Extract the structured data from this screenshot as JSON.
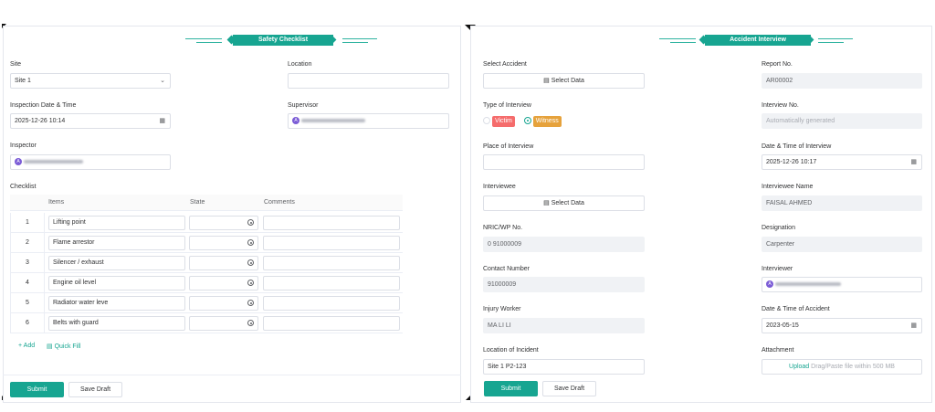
{
  "colors": {
    "accent": "#17a591",
    "victim": "#f56c6c",
    "witness": "#e6a23c",
    "avatar": "#7b5cd6"
  },
  "left": {
    "header_title": "Safety Checklist",
    "site_label": "Site",
    "site_value": "Site 1",
    "location_label": "Location",
    "location_value": "",
    "inspection_dt_label": "Inspection Date & Time",
    "inspection_dt_value": "2025-12-26 10:14",
    "supervisor_label": "Supervisor",
    "supervisor_avatar": "A",
    "inspector_label": "Inspector",
    "inspector_avatar": "A",
    "checklist_label": "Checklist",
    "columns": [
      "Items",
      "State",
      "Comments"
    ],
    "rows": [
      {
        "no": "1",
        "item": "Lifting point"
      },
      {
        "no": "2",
        "item": "Flame arrestor"
      },
      {
        "no": "3",
        "item": "Silencer / exhaust"
      },
      {
        "no": "4",
        "item": "Engine oil level"
      },
      {
        "no": "5",
        "item": "Radiator water leve"
      },
      {
        "no": "6",
        "item": "Belts with guard"
      }
    ],
    "add_label": "Add",
    "quick_fill_label": "Quick Fill",
    "submit_label": "Submit",
    "save_draft_label": "Save Draft"
  },
  "right": {
    "header_title": "Accident Interview",
    "select_accident_label": "Select Accident",
    "select_data_label": "Select Data",
    "report_no_label": "Report No.",
    "report_no_value": "AR00002",
    "type_label": "Type of Interview",
    "victim_label": "Victim",
    "witness_label": "Witness",
    "interview_no_label": "Interview No.",
    "interview_no_placeholder": "Automatically generated",
    "place_label": "Place of Interview",
    "dt_interview_label": "Date & Time of Interview",
    "dt_interview_value": "2025-12-26 10:17",
    "interviewee_label": "Interviewee",
    "interviewee_name_label": "Interviewee Name",
    "interviewee_name_value": "FAISAL AHMED",
    "nric_label": "NRIC/WP No.",
    "nric_value": "0 91000009",
    "designation_label": "Designation",
    "designation_value": "Carpenter",
    "contact_label": "Contact Number",
    "contact_value": "91000009",
    "interviewer_label": "Interviewer",
    "interviewer_avatar": "A",
    "injury_label": "Injury Worker",
    "injury_value": "MA LI LI",
    "dt_accident_label": "Date & Time of Accident",
    "dt_accident_value": "2023-05-15",
    "location_incident_label": "Location of Incident",
    "location_incident_value": "Site 1 P2-123",
    "attachment_label": "Attachment",
    "upload_label": "Upload",
    "upload_hint": "Drag/Paste file within 500 MB",
    "submit_label": "Submit",
    "save_draft_label": "Save Draft"
  }
}
